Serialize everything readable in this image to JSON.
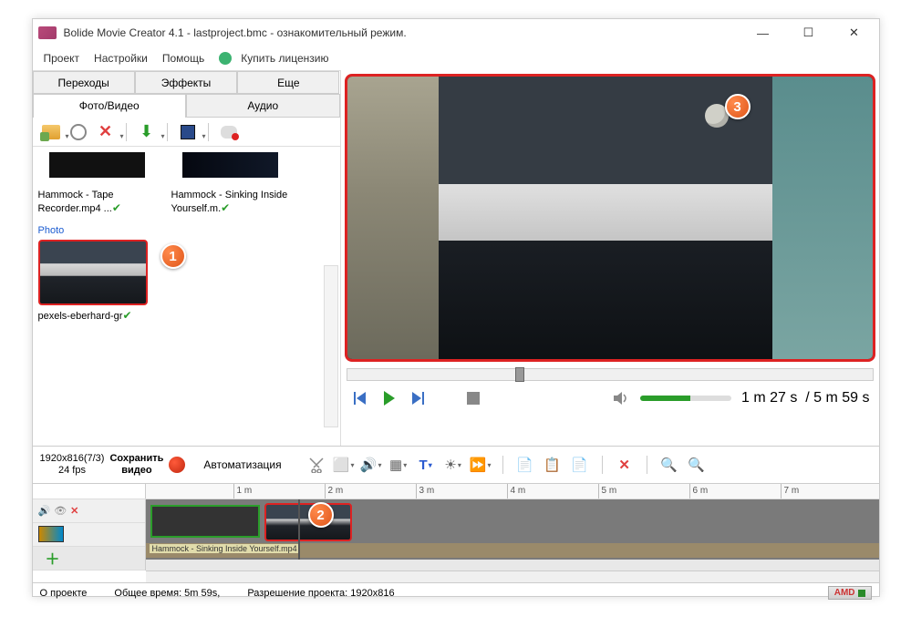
{
  "titlebar": {
    "text": "Bolide Movie Creator 4.1 - lastproject.bmc  - ознакомительный режим."
  },
  "menu": {
    "project": "Проект",
    "settings": "Настройки",
    "help": "Помощь",
    "buy": "Купить лицензию"
  },
  "left_tabs": {
    "transitions": "Переходы",
    "effects": "Эффекты",
    "more": "Еще",
    "photo_video": "Фото/Видео",
    "audio": "Аудио"
  },
  "media": {
    "item1": "Hammock - Tape Recorder.mp4 ...",
    "item2": "Hammock - Sinking Inside Yourself.m.",
    "photo_section": "Photo",
    "photo_name": "pexels-eberhard-gr"
  },
  "playback": {
    "current": "1 m 27 s",
    "sep": "/",
    "total": "5 m 59 s"
  },
  "timeline_toolbar": {
    "resolution": "1920x816(7/3)",
    "fps": "24 fps",
    "save_line1": "Сохранить",
    "save_line2": "видео",
    "automation": "Автоматизация"
  },
  "ruler": {
    "t1": "1 m",
    "t2": "2 m",
    "t3": "3 m",
    "t4": "4 m",
    "t5": "5 m",
    "t6": "6 m",
    "t7": "7 m"
  },
  "tracks": {
    "audio_clip_label": "Hammock - Sinking Inside Yourself.mp4"
  },
  "statusbar": {
    "about": "О проекте",
    "total_time": "Общее время:  5m 59s,",
    "proj_res": "Разрешение проекта:    1920x816",
    "amd": "AMD"
  }
}
